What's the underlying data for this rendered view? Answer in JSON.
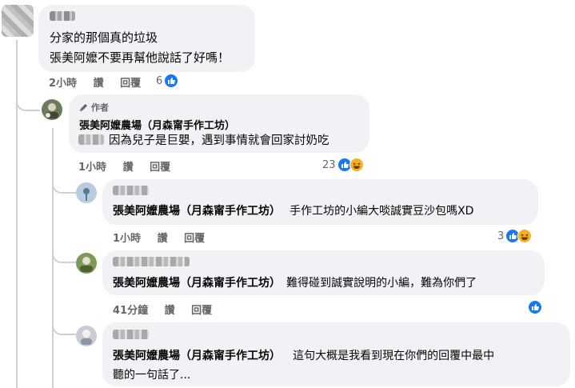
{
  "comment1": {
    "text_line1": "分家的那個真的垃圾",
    "text_line2": "張美阿嬤不要再幫他說話了好嗎！",
    "time": "2小時",
    "like": "讚",
    "reply": "回覆",
    "reaction_count": "6"
  },
  "reply1": {
    "badge": "作者",
    "author": "張美阿嬤農場（月森甯手作工坊）",
    "text": "因為兒子是巨嬰，遇到事情就會回家討奶吃",
    "time": "1小時",
    "like": "讚",
    "reply": "回覆",
    "reaction_count": "23"
  },
  "reply2": {
    "mention": "張美阿嬤農場（月森甯手作工坊）",
    "text": "手作工坊的小編大啖誠實豆沙包嗎XD",
    "time": "1小時",
    "like": "讚",
    "reply": "回覆",
    "reaction_count": "3"
  },
  "reply3": {
    "mention": "張美阿嬤農場（月森甯手作工坊）",
    "text": "難得碰到誠實說明的小編，難為你們了",
    "time": "41分鐘",
    "like": "讚",
    "reply": "回覆"
  },
  "reply4": {
    "mention": "張美阿嬤農場（月森甯手作工坊）",
    "text_line1": "這句大概是我看到現在你們的回覆中最中",
    "text_line2": "聽的一句話了..."
  },
  "colors": {
    "bubble": "#f0f2f5",
    "meta_text": "#65676b",
    "like_blue": "#1877f2",
    "haha_yellow": "#f7b125"
  },
  "icons": [
    "pencil-icon",
    "like-icon",
    "haha-icon"
  ]
}
